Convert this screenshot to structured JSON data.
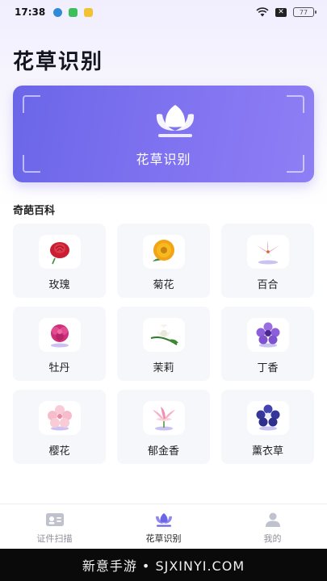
{
  "status_bar": {
    "time": "17:38",
    "battery": "77",
    "app_icon_colors": [
      "#2f8bd8",
      "#3fbf5a",
      "#f1c232"
    ]
  },
  "page_title": "花草识别",
  "hero": {
    "label": "花草识别",
    "icon": "lotus-icon",
    "accent": "#7a6ff0"
  },
  "section": {
    "title": "奇葩百科"
  },
  "flowers": [
    {
      "label": "玫瑰",
      "icon": "rose-icon",
      "color": "#d8283c"
    },
    {
      "label": "菊花",
      "icon": "chrysanthemum-icon",
      "color": "#f0a818"
    },
    {
      "label": "百合",
      "icon": "lily-icon",
      "color": "#f2b6cf"
    },
    {
      "label": "牡丹",
      "icon": "peony-icon",
      "color": "#d0307a"
    },
    {
      "label": "茉莉",
      "icon": "jasmine-icon",
      "color": "#f2f2ea"
    },
    {
      "label": "丁香",
      "icon": "lilac-icon",
      "color": "#8a5ad8"
    },
    {
      "label": "樱花",
      "icon": "sakura-icon",
      "color": "#f7c2cf"
    },
    {
      "label": "郁金香",
      "icon": "tulip-icon",
      "color": "#f4a0bc"
    },
    {
      "label": "薰衣草",
      "icon": "lavender-icon",
      "color": "#3a3a9e"
    }
  ],
  "tabs": [
    {
      "label": "证件扫描",
      "icon": "id-card-icon",
      "active": false
    },
    {
      "label": "花草识别",
      "icon": "lotus-icon",
      "active": true
    },
    {
      "label": "我的",
      "icon": "person-icon",
      "active": false
    }
  ],
  "watermark": "新意手游 • SJXINYI.COM"
}
